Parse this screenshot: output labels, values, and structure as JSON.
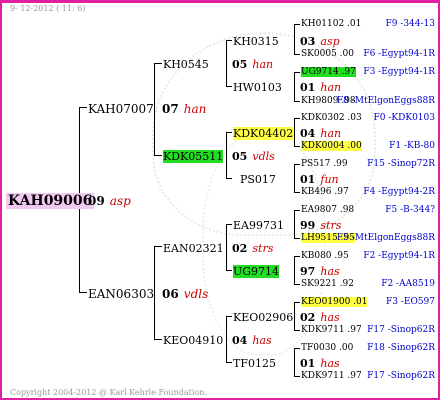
{
  "header": {
    "date": "9- 12-2012 ( 11: 6)"
  },
  "footer": {
    "copyright": "Copyright 2004-2012 @ Karl Kehrle Foundation."
  },
  "colors": {
    "frame": "#e020a0",
    "root_bg": "#f0c8f0",
    "green_hl": "#22dd22",
    "yellow_hl": "#ffff44",
    "info_text": "#0000cc",
    "colony_text": "#cc0000"
  },
  "pedigree": {
    "root": {
      "id": "KAH09006"
    },
    "gen2": [
      {
        "id": "KAH07007",
        "num": "07",
        "colony": "han"
      },
      {
        "id": "EAN06303",
        "num": "06",
        "colony": "vdls"
      }
    ],
    "gen1_mid": {
      "num": "09",
      "colony": "asp"
    },
    "gen3": [
      {
        "id": "KH0545",
        "num": "05",
        "colony": "han"
      },
      {
        "id": "KDK05511",
        "num": "05",
        "colony": "vdls"
      },
      {
        "id": "EAN02321",
        "num": "02",
        "colony": "strs"
      },
      {
        "id": "KEO04910",
        "num": "04",
        "colony": "has"
      }
    ],
    "gen4": [
      {
        "id": "KH0315",
        "num": "03",
        "colony": "asp"
      },
      {
        "id": "HW0103",
        "num": "01",
        "colony": "han"
      },
      {
        "id": "KDK04402",
        "num": "04",
        "colony": "han"
      },
      {
        "id": "PS017",
        "num": "01",
        "colony": "fun"
      },
      {
        "id": "EA99731",
        "num": "99",
        "colony": "strs"
      },
      {
        "id": "UG9714",
        "num": "97",
        "colony": "has"
      },
      {
        "id": "KEO02906",
        "num": "02",
        "colony": "has"
      },
      {
        "id": "TF0125",
        "num": "01",
        "colony": "has"
      }
    ],
    "gen5": [
      {
        "left": "KH01102 .01",
        "right": "F9 -344-13"
      },
      {
        "left": "SK0005 .00",
        "right": "F6 -Egypt94-1R"
      },
      {
        "left": "UG9714 .97",
        "right": "F3 -Egypt94-1R"
      },
      {
        "left": "KH9809 .98",
        "right": "F8 -MtElgonEggs88R"
      },
      {
        "left": "KDK0302 .03",
        "right": "F0 -KDK0103"
      },
      {
        "left": "KDK0004 .00",
        "right": "F1 -KB-80"
      },
      {
        "left": "PS517 .99",
        "right": "F15 -Sinop72R"
      },
      {
        "left": "KB496 .97",
        "right": "F4 -Egypt94-2R"
      },
      {
        "left": "EA9807 .98",
        "right": "F5 -B-344?"
      },
      {
        "left": "LH9515 .95",
        "right": "F5 -MtElgonEggs88R"
      },
      {
        "left": "KB080 .95",
        "right": "F2 -Egypt94-1R"
      },
      {
        "left": "SK9221 .92",
        "right": "F2 -AA8519"
      },
      {
        "left": "KEO01900 .01",
        "right": "F3 -EO597"
      },
      {
        "left": "KDK9711 .97",
        "right": "F17 -Sinop62R"
      },
      {
        "left": "TF0030 .00",
        "right": "F18 -Sinop62R"
      },
      {
        "left": "KDK9711 .97",
        "right": "F17 -Sinop62R"
      }
    ]
  }
}
